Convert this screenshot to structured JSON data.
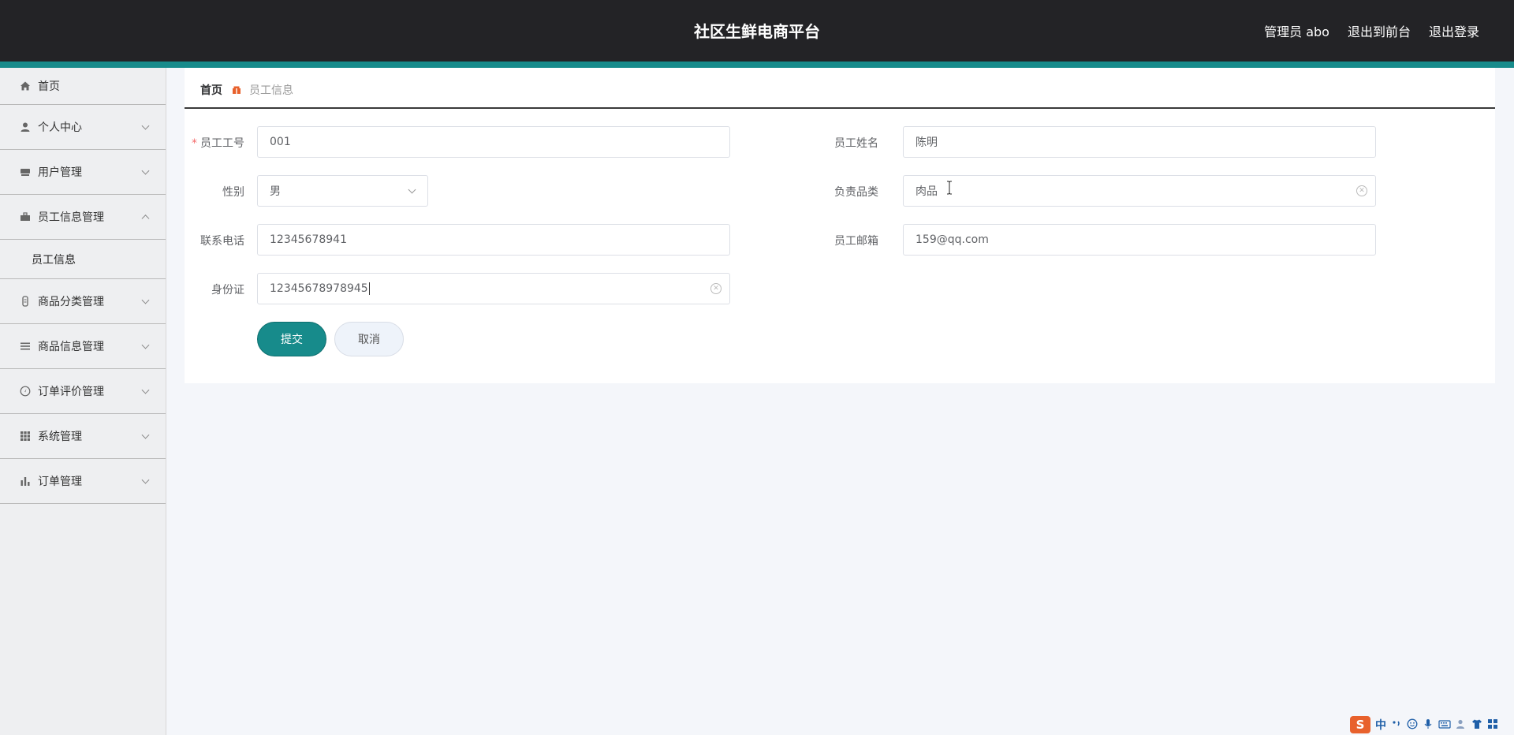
{
  "header": {
    "app_title": "社区生鲜电商平台",
    "admin_label": "管理员 abo",
    "frontend_link": "退出到前台",
    "logout_link": "退出登录"
  },
  "sidebar": {
    "items": [
      {
        "label": "首页",
        "icon": "home-icon"
      },
      {
        "label": "个人中心",
        "icon": "user-icon"
      },
      {
        "label": "用户管理",
        "icon": "users-icon"
      },
      {
        "label": "员工信息管理",
        "icon": "briefcase-icon"
      },
      {
        "label": "员工信息"
      },
      {
        "label": "商品分类管理",
        "icon": "tag-icon"
      },
      {
        "label": "商品信息管理",
        "icon": "list-icon"
      },
      {
        "label": "订单评价管理",
        "icon": "compass-icon"
      },
      {
        "label": "系统管理",
        "icon": "grid-icon"
      },
      {
        "label": "订单管理",
        "icon": "bar-chart-icon"
      }
    ]
  },
  "breadcrumb": {
    "home": "首页",
    "current": "员工信息"
  },
  "form": {
    "employee_no": {
      "label": "员工工号",
      "value": "001"
    },
    "employee_name": {
      "label": "员工姓名",
      "value": "陈明"
    },
    "gender": {
      "label": "性别",
      "value": "男"
    },
    "category": {
      "label": "负责品类",
      "value": "肉品"
    },
    "phone": {
      "label": "联系电话",
      "value": "12345678941"
    },
    "email": {
      "label": "员工邮箱",
      "value": "159@qq.com"
    },
    "id_card": {
      "label": "身份证",
      "value": "12345678978945"
    },
    "submit_label": "提交",
    "cancel_label": "取消"
  },
  "ime": {
    "logo": "S",
    "mode": "中"
  },
  "colors": {
    "header_bg": "#232326",
    "accent": "#178b8b",
    "breadcrumb_sep": "#e8612c"
  }
}
